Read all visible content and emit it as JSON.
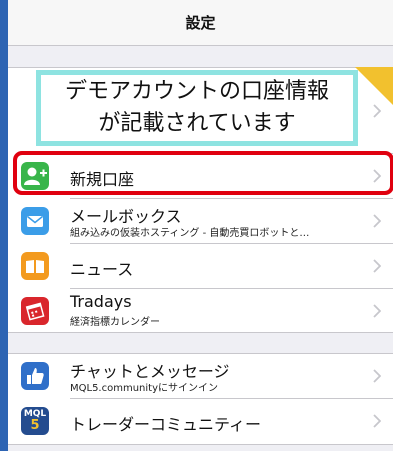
{
  "nav": {
    "title": "設定"
  },
  "demo_banner": {
    "line1": "デモアカウントの口座情報",
    "line2": "が記載されています"
  },
  "group1": [
    {
      "key": "new-account",
      "title": "新規口座",
      "icon": "person-add-icon",
      "color": "#38b54a"
    },
    {
      "key": "mailbox",
      "title": "メールボックス",
      "subtitle": "組み込みの仮装ホスティング - 自動売買ロボットと…",
      "icon": "mail-icon",
      "color": "#3b9de8"
    },
    {
      "key": "news",
      "title": "ニュース",
      "icon": "book-icon",
      "color": "#f39a1e"
    },
    {
      "key": "tradays",
      "title": "Tradays",
      "subtitle": "経済指標カレンダー",
      "icon": "calendar-icon",
      "color": "#d9262c"
    }
  ],
  "group2": [
    {
      "key": "chat",
      "title": "チャットとメッセージ",
      "subtitle": "MQL5.communityにサインイン",
      "icon": "thumbs-up-icon",
      "color": "#2f6fc9"
    },
    {
      "key": "community",
      "title": "トレーダーコミュニティー",
      "icon": "mql5-icon",
      "color": "#244c8f"
    }
  ],
  "icons": {
    "chevron": "chevron-right-icon",
    "mql5_text": "MQL",
    "mql5_digit": "5"
  }
}
